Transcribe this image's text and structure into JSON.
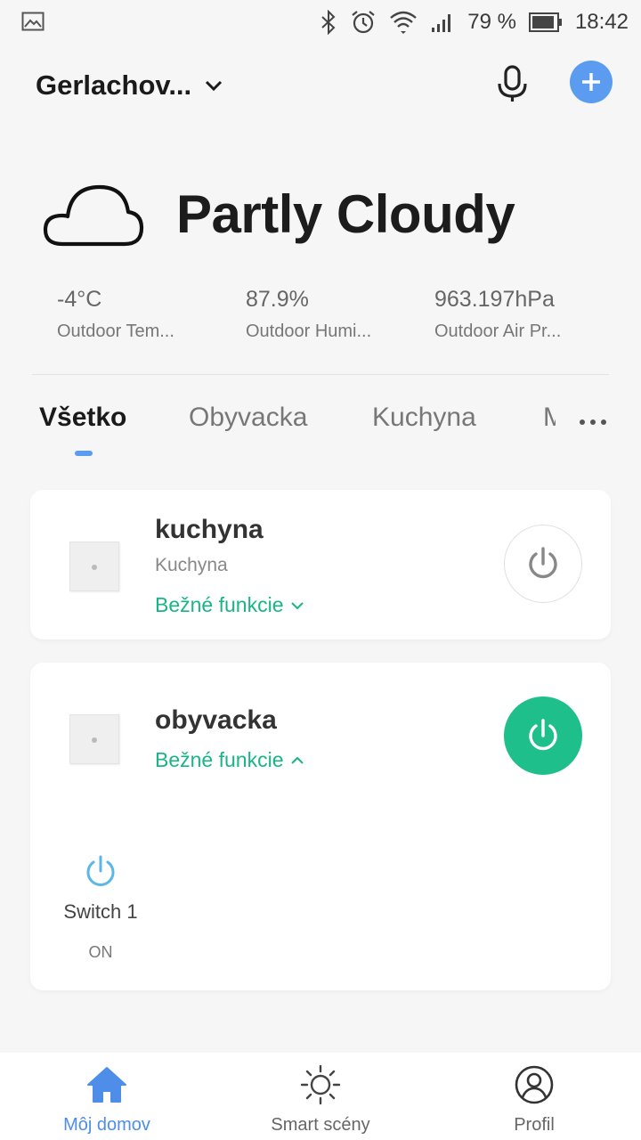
{
  "status_bar": {
    "battery": "79 %",
    "time": "18:42"
  },
  "header": {
    "home_name": "Gerlachov...",
    "icons": [
      "chevron-down-icon",
      "microphone-icon",
      "add-icon"
    ]
  },
  "weather": {
    "condition": "Partly Cloudy",
    "stats": [
      {
        "value": "-4°C",
        "label": "Outdoor Tem..."
      },
      {
        "value": "87.9%",
        "label": "Outdoor Humi..."
      },
      {
        "value": "963.197hPa",
        "label": "Outdoor Air Pr..."
      }
    ]
  },
  "tabs": [
    {
      "label": "Všetko",
      "active": true
    },
    {
      "label": "Obyvacka"
    },
    {
      "label": "Kuchyna"
    },
    {
      "label": "M"
    }
  ],
  "devices": [
    {
      "name": "kuchyna",
      "room": "Kuchyna",
      "functions_label": "Bežné funkcie",
      "power": "off"
    },
    {
      "name": "obyvacka",
      "functions_label": "Bežné funkcie",
      "power": "on",
      "switches": [
        {
          "name": "Switch 1",
          "state": "ON"
        }
      ]
    }
  ],
  "bottom_nav": [
    {
      "label": "Môj domov",
      "icon": "home-icon",
      "active": true
    },
    {
      "label": "Smart scény",
      "icon": "sun-icon"
    },
    {
      "label": "Profil",
      "icon": "profile-icon"
    }
  ],
  "colors": {
    "accent": "#5b9cf1",
    "green": "#1fbf8b",
    "function_text": "#19b587"
  }
}
